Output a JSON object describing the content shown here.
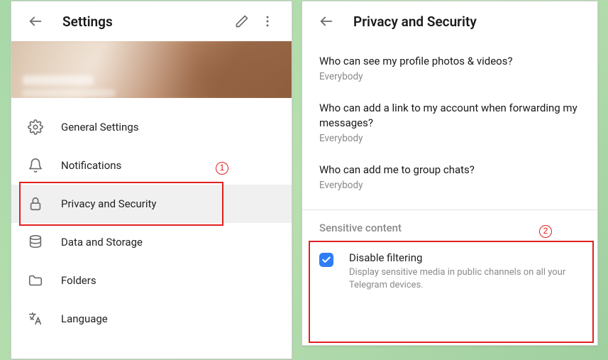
{
  "left": {
    "title": "Settings",
    "menu": [
      {
        "icon": "gear",
        "label": "General Settings"
      },
      {
        "icon": "bell",
        "label": "Notifications"
      },
      {
        "icon": "lock",
        "label": "Privacy and Security",
        "selected": true
      },
      {
        "icon": "database",
        "label": "Data and Storage"
      },
      {
        "icon": "folder",
        "label": "Folders"
      },
      {
        "icon": "language",
        "label": "Language"
      }
    ]
  },
  "right": {
    "title": "Privacy and Security",
    "rows": [
      {
        "q": "Who can see my profile photos & videos?",
        "a": "Everybody"
      },
      {
        "q": "Who can add a link to my account when forwarding my messages?",
        "a": "Everybody"
      },
      {
        "q": "Who can add me to group chats?",
        "a": "Everybody"
      }
    ],
    "section_title": "Sensitive content",
    "check": {
      "checked": true,
      "title": "Disable filtering",
      "desc": "Display sensitive media in public channels on all your Telegram devices."
    }
  },
  "annotations": {
    "one": "1",
    "two": "2"
  }
}
